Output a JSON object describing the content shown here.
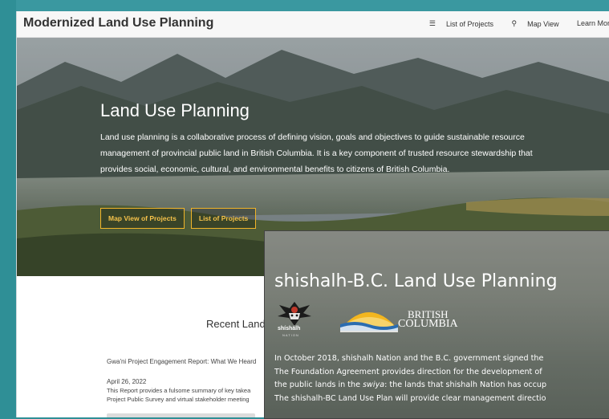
{
  "site": {
    "title": "Modernized Land Use Planning",
    "nav": [
      {
        "icon": "list-icon",
        "label": "List of Projects"
      },
      {
        "icon": "search-icon",
        "label": "Map View"
      },
      {
        "icon": "",
        "label": "Learn Mor"
      }
    ]
  },
  "hero": {
    "title": "Land Use Planning",
    "body": "Land use planning is a collaborative process of defining vision, goals and objectives to guide sustainable resource management of provincial public land in British Columbia. It is a key component of trusted resource stewardship that provides social, economic, cultural, and environmental benefits to citizens of British Columbia.",
    "buttons": [
      "Map View of Projects",
      "List of Projects"
    ]
  },
  "recent": {
    "title": "Recent Land",
    "item_title": "Gwa'ni Project Engagement Report: What We Heard",
    "item_date": "April 26, 2022",
    "item_desc_1": "This Report provides a fulsome summary of key takea",
    "item_desc_2": "Project Public Survey and virtual stakeholder meeting"
  },
  "overlay": {
    "title": "shishalh-B.C. Land Use Planning",
    "nation_logo_text": "shíshálh",
    "nation_logo_sub": "NATION",
    "bc_line1": "BRITISH",
    "bc_line2": "COLUMBIA",
    "body_1": "In October 2018, shishalh Nation and the B.C. government signed the",
    "body_2": "The Foundation Agreement provides direction for the development of",
    "body_3_pre": "the public lands in the ",
    "body_3_em": "swiya",
    "body_3_post": ": the lands that shishalh Nation has occup",
    "body_4": "The shishalh-BC Land Use Plan will provide clear management directio"
  },
  "colors": {
    "frame": "#2f8f96",
    "button_accent": "#f0b429"
  }
}
